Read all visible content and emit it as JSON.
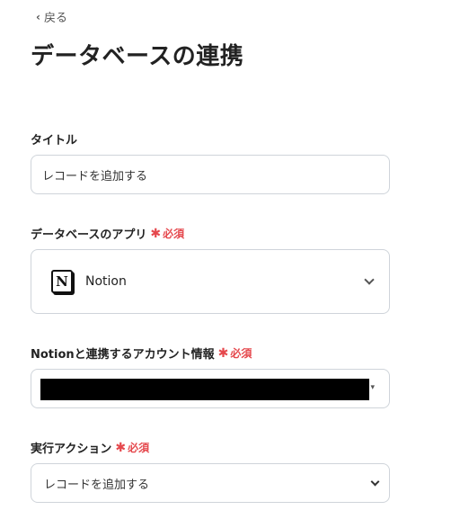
{
  "header": {
    "back_label": "戻る",
    "back_icon": "chevron-left-icon",
    "title": "データベースの連携"
  },
  "fields": {
    "title": {
      "label": "タイトル",
      "value": "レコードを追加する"
    },
    "database_app": {
      "label": "データベースのアプリ",
      "required": "必須",
      "app_icon": "notion-logo-icon",
      "app_name": "Notion"
    },
    "account": {
      "label": "Notionと連携するアカウント情報",
      "required": "必須"
    },
    "action": {
      "label": "実行アクション",
      "required": "必須",
      "value": "レコードを追加する"
    }
  },
  "colors": {
    "required": "#e5484d",
    "border": "#cfd4da",
    "text": "#222222"
  }
}
